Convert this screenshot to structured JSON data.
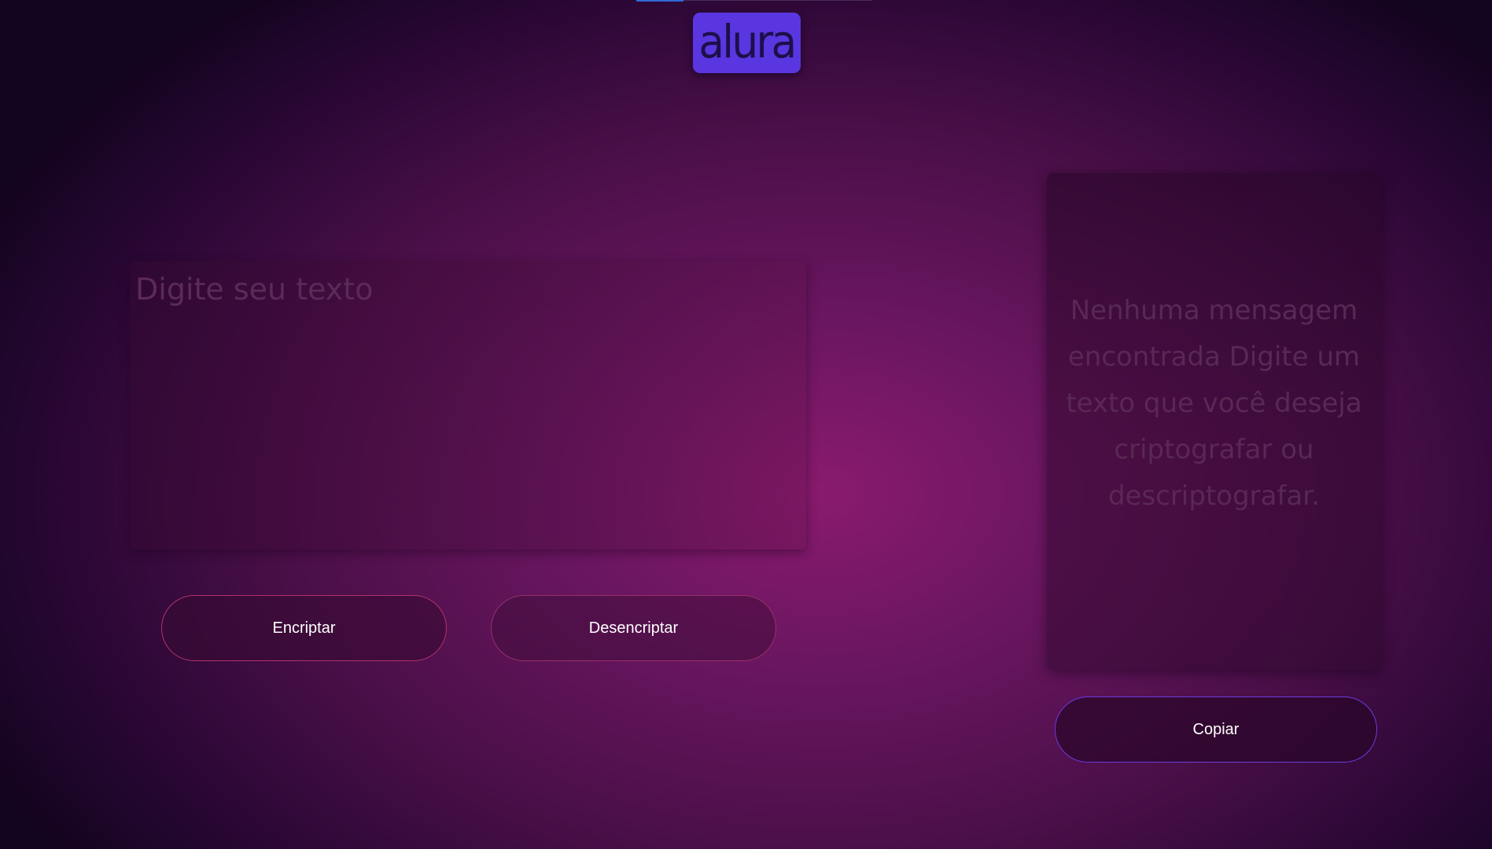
{
  "header": {
    "logo_text": "alura"
  },
  "input": {
    "placeholder": "Digite seu texto",
    "value": ""
  },
  "actions": {
    "encrypt_label": "Encriptar",
    "decrypt_label": "Desencriptar",
    "copy_label": "Copiar"
  },
  "output": {
    "empty_message": "Nenhuma mensagem encontrada Digite um texto que você deseja criptografar ou descriptografar."
  },
  "colors": {
    "logo_background": "#5a36e0",
    "logo_text": "#1d0f4a",
    "encrypt_border": "#b0306f",
    "copy_border": "#6a3ae0",
    "button_text": "#ffffff"
  }
}
